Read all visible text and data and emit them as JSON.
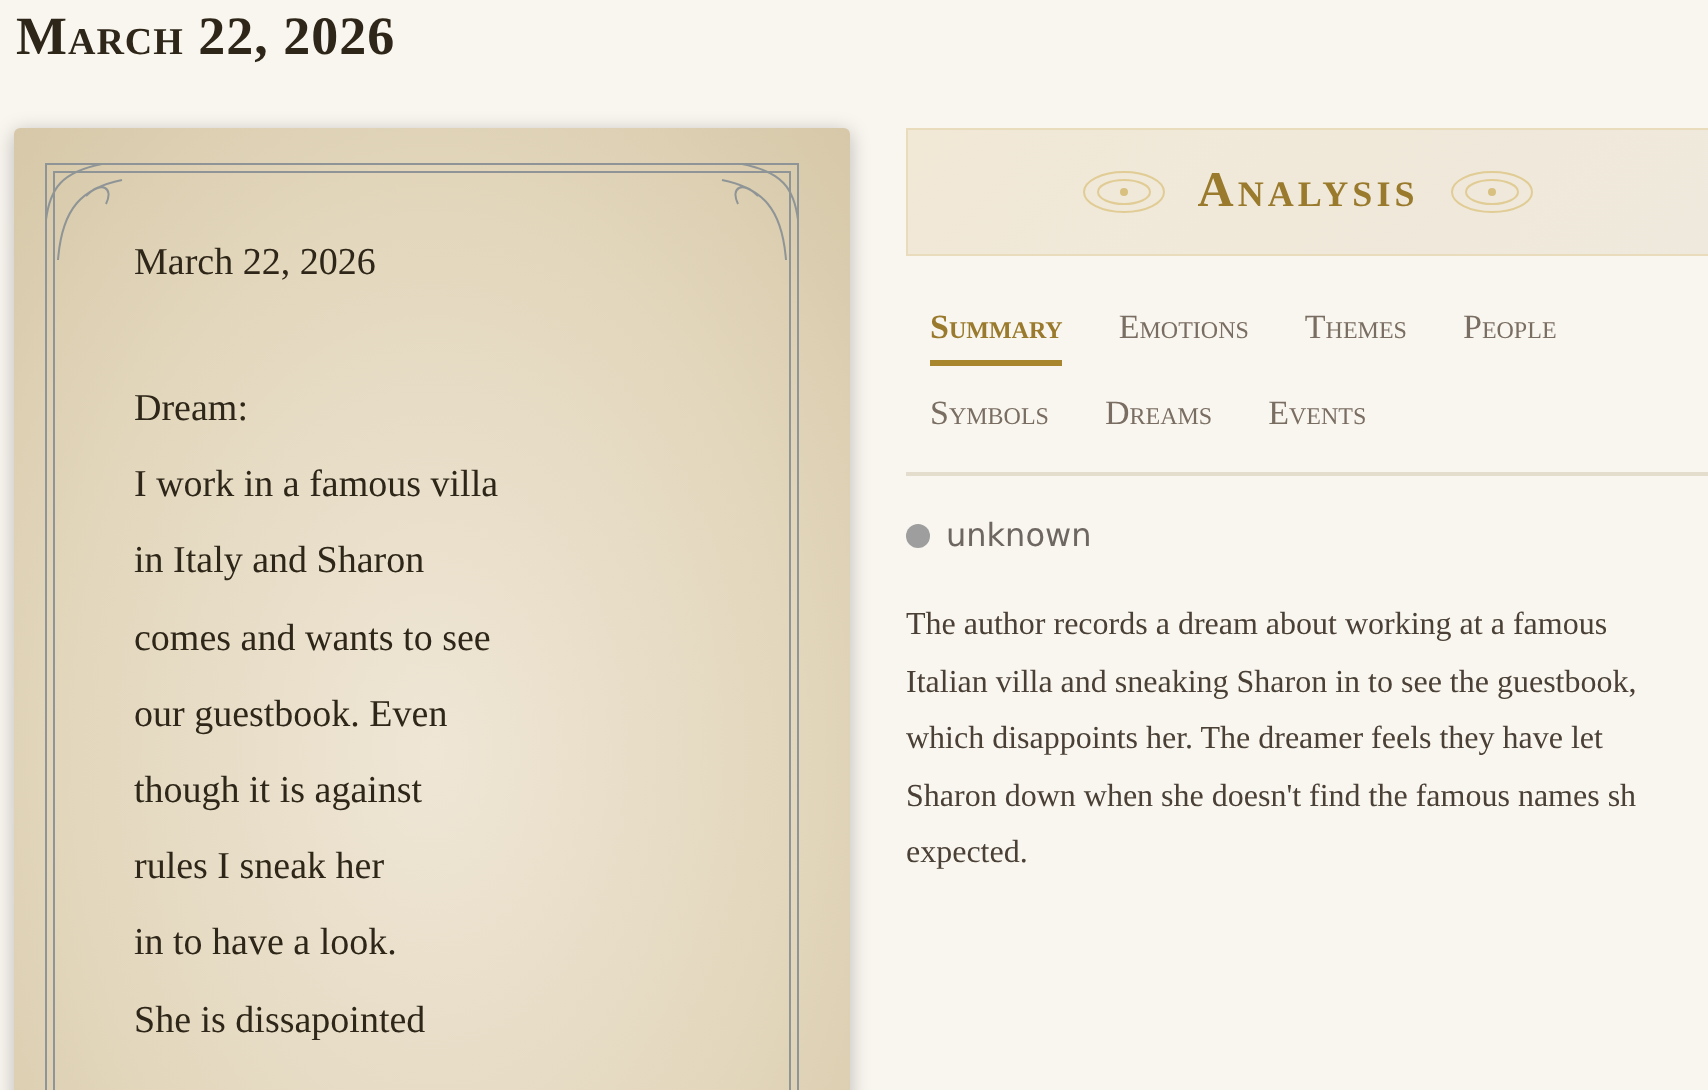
{
  "page_title": "March 22, 2026",
  "journal": {
    "date": "March 22, 2026",
    "lines": [
      "Dream:",
      "I work in a famous villa",
      "in Italy and Sharon",
      "comes and wants to see",
      "our guestbook. Even",
      "though it is against",
      "rules I sneak her",
      "in to have a look.",
      "She is dissapointed"
    ]
  },
  "analysis": {
    "title": "Analysis",
    "tabs": [
      {
        "label": "Summary",
        "selected": true
      },
      {
        "label": "Emotions",
        "selected": false
      },
      {
        "label": "Themes",
        "selected": false
      },
      {
        "label": "People",
        "selected": false
      },
      {
        "label": "Symbols",
        "selected": false
      },
      {
        "label": "Dreams",
        "selected": false
      },
      {
        "label": "Events",
        "selected": false
      }
    ],
    "status": {
      "label": "unknown",
      "color": "#9e9e9e"
    },
    "summary_lines": [
      "The author records a dream about working at a famous",
      "Italian villa and sneaking Sharon in to see the guestbook,",
      "which disappoints her. The dreamer feels they have let",
      "Sharon down when she doesn't find the famous names sh",
      "expected."
    ]
  }
}
